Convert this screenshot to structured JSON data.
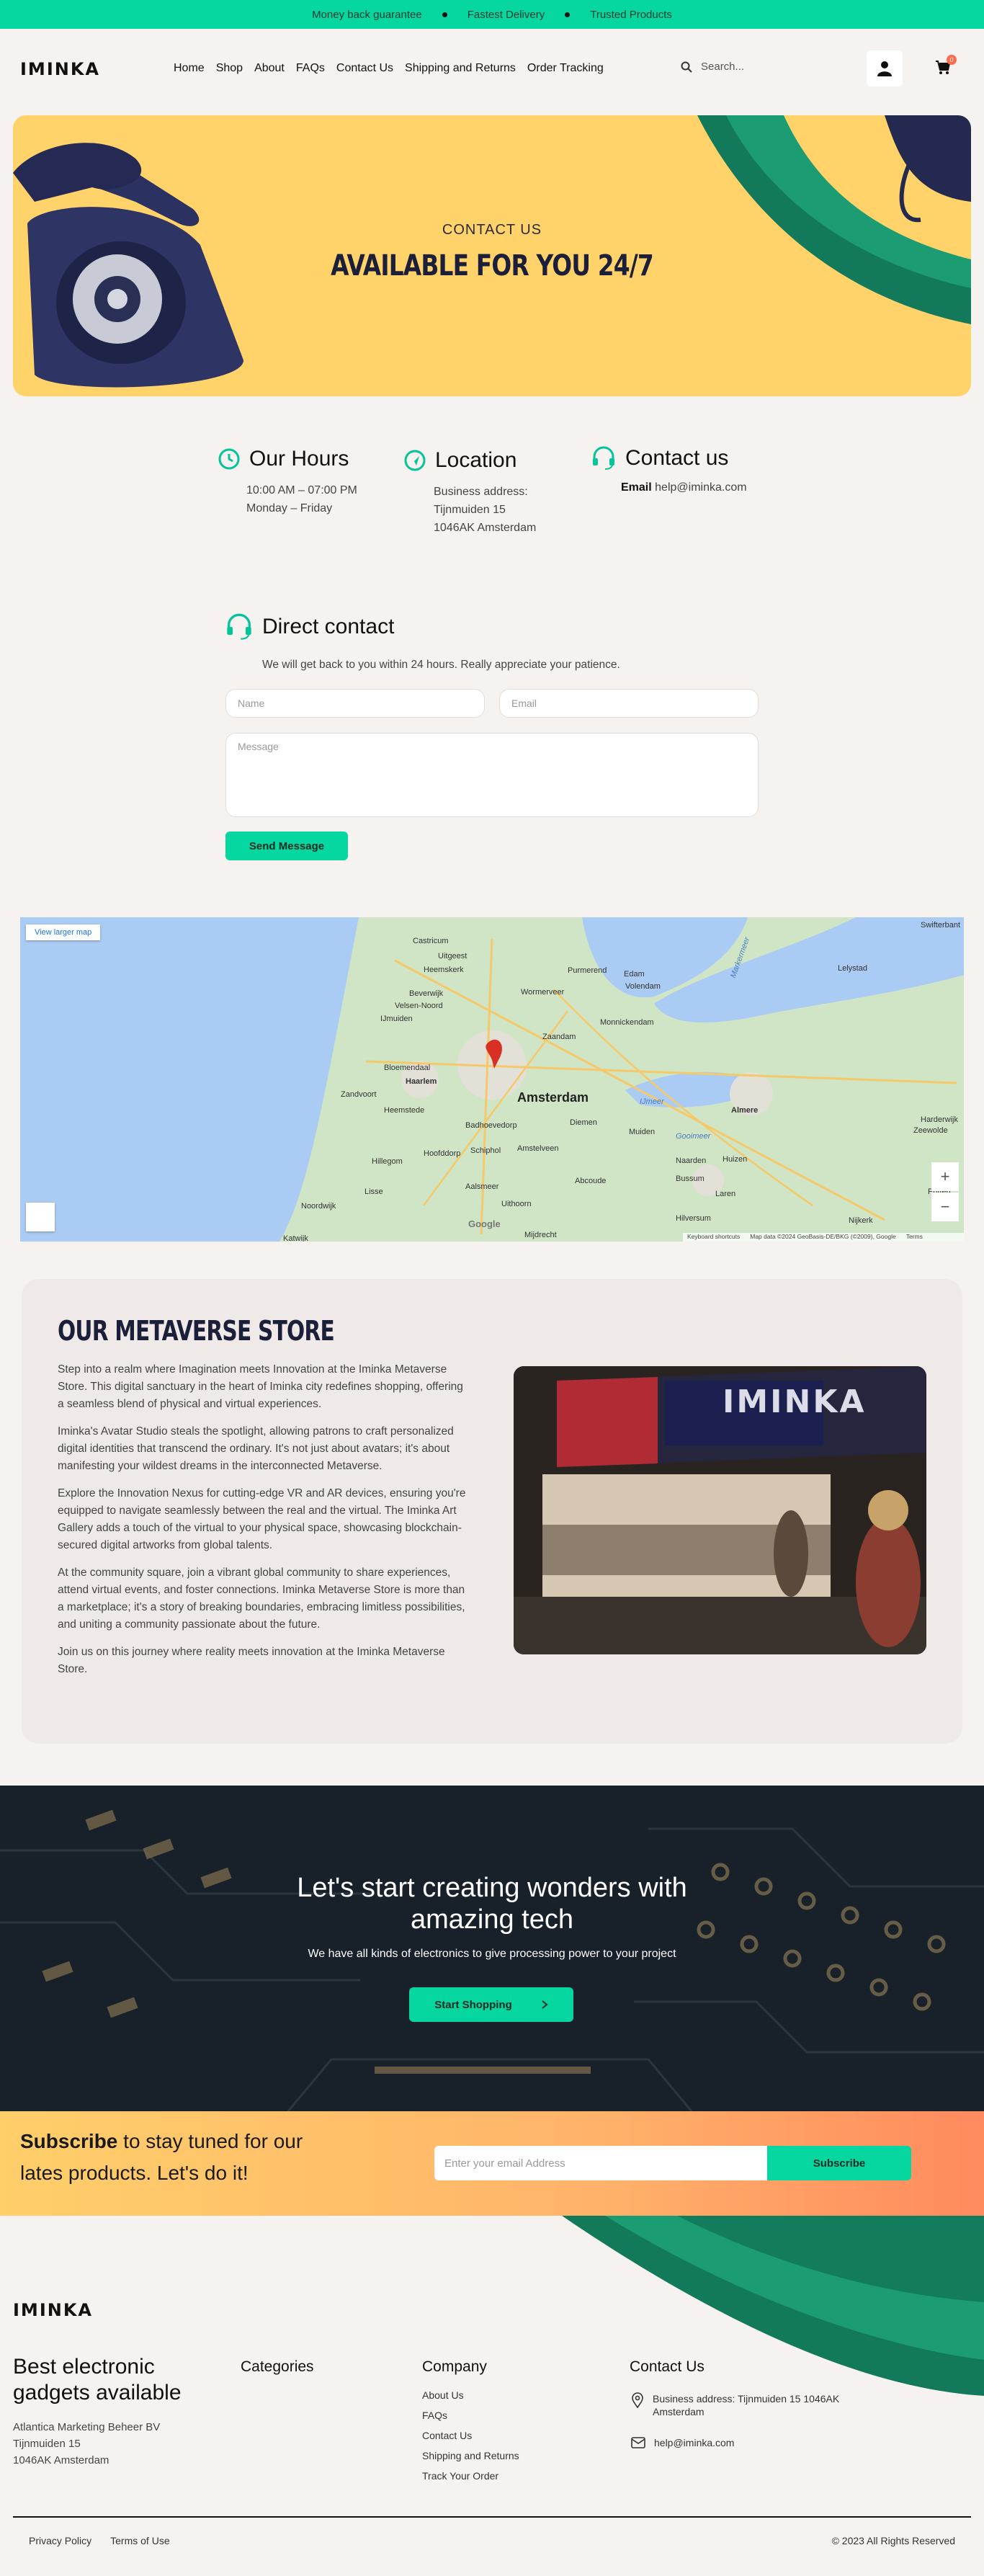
{
  "colors": {
    "accent": "#06d6a0",
    "hero_bg": "#ffd369",
    "navy": "#1c1f3a",
    "badge": "#ff6b4a"
  },
  "topbar": {
    "items": [
      "Money back guarantee",
      "Fastest Delivery",
      "Trusted Products"
    ]
  },
  "header": {
    "logo": "IMINKA",
    "nav": [
      "Home",
      "Shop",
      "About",
      "FAQs",
      "Contact Us",
      "Shipping and Returns",
      "Order Tracking"
    ],
    "search_placeholder": "Search...",
    "cart_count": "0",
    "icons": {
      "search": "search-icon",
      "account": "user-icon",
      "cart": "cart-icon"
    }
  },
  "hero": {
    "small": "CONTACT US",
    "big": "AVAILABLE FOR YOU 24/7"
  },
  "info": {
    "hours": {
      "title": "Our Hours",
      "lines": [
        "10:00 AM – 07:00 PM",
        "Monday – Friday"
      ]
    },
    "location": {
      "title": "Location",
      "lines": [
        "Business address:",
        "Tijnmuiden 15",
        "1046AK Amsterdam"
      ]
    },
    "contact": {
      "title": "Contact us",
      "email_label": "Email",
      "email": "help@iminka.com"
    }
  },
  "direct": {
    "title": "Direct contact",
    "subtitle": "We will get back to you within 24 hours. Really appreciate your patience.",
    "name_placeholder": "Name",
    "email_placeholder": "Email",
    "message_placeholder": "Message",
    "send": "Send Message"
  },
  "map": {
    "view_larger": "View larger map",
    "city": "Amsterdam",
    "labels": [
      "Castricum",
      "Uitgeest",
      "Heemskerk",
      "Purmerend",
      "Edam",
      "Volendam",
      "Wormerveer",
      "Beverwijk",
      "Velsen-Noord",
      "IJmuiden",
      "Zaandam",
      "Monnickendam",
      "Bloemendaal",
      "Haarlem",
      "Zandvoort",
      "Heemstede",
      "Badhoevedorp",
      "Diemen",
      "Muiden",
      "Almere",
      "Hoofddorp",
      "Schiphol",
      "Amstelveen",
      "Naarden",
      "Huizen",
      "Hillegom",
      "Lisse",
      "Aalsmeer",
      "Abcoude",
      "Bussum",
      "Laren",
      "Noordwijk",
      "Uithoorn",
      "Hilversum",
      "Nijkerk",
      "Lelystad",
      "Zeewolde",
      "Harderwijk",
      "Swifterbant",
      "Putten",
      "Mijdrecht",
      "Katwijk",
      "Gooimeer",
      "Markermeer",
      "IJmeer"
    ],
    "footer_text": [
      "Keyboard shortcuts",
      "Map data ©2024 GeoBasis-DE/BKG (©2009), Google",
      "Terms"
    ],
    "zoom_in": "+",
    "zoom_out": "−",
    "google": "Google"
  },
  "store": {
    "title": "OUR METAVERSE STORE",
    "paragraphs": [
      "Step into a realm where Imagination meets Innovation at the Iminka Metaverse Store. This digital sanctuary in the heart of Iminka city redefines shopping, offering a seamless blend of physical and virtual experiences.",
      "Iminka's Avatar Studio steals the spotlight, allowing patrons to craft personalized digital identities that transcend the ordinary. It's not just about avatars; it's about manifesting your wildest dreams in the interconnected Metaverse.",
      "Explore the Innovation Nexus for cutting-edge VR and AR devices, ensuring you're equipped to navigate seamlessly between the real and the virtual. The Iminka Art Gallery adds a touch of the virtual to your physical space, showcasing blockchain-secured digital artworks from global talents.",
      "At the community square, join a vibrant global community to share experiences, attend virtual events, and foster connections. Iminka Metaverse Store is more than a marketplace; it's a story of breaking boundaries, embracing limitless possibilities, and uniting a community passionate about the future.",
      "Join us on this journey where reality meets innovation at the Iminka Metaverse Store."
    ],
    "sign": "IMINKA"
  },
  "tech": {
    "title_line1": "Let's start creating wonders with",
    "title_line2": "amazing tech",
    "subtitle": "We have all kinds of electronics to give processing power to your project",
    "button": "Start Shopping"
  },
  "subscribe": {
    "bold": "Subscribe",
    "rest_line1": " to stay tuned for our",
    "line2": "lates products. Let's do it!",
    "placeholder": "Enter your email Address",
    "button": "Subscribe"
  },
  "footer": {
    "logo": "IMINKA",
    "tagline_line1": "Best electronic",
    "tagline_line2": "gadgets available",
    "address": [
      "Atlantica Marketing Beheer BV",
      "Tijnmuiden 15",
      "1046AK Amsterdam"
    ],
    "categories_title": "Categories",
    "company_title": "Company",
    "company_links": [
      "About Us",
      "FAQs",
      "Contact Us",
      "Shipping and Returns",
      "Track Your Order"
    ],
    "contact_title": "Contact Us",
    "contact_address_line1": "Business address: Tijnmuiden 15 1046AK",
    "contact_address_line2": "Amsterdam",
    "contact_email": "help@iminka.com",
    "bottom_links": [
      "Privacy Policy",
      "Terms of Use"
    ],
    "copyright": "© 2023 All Rights Reserved"
  }
}
